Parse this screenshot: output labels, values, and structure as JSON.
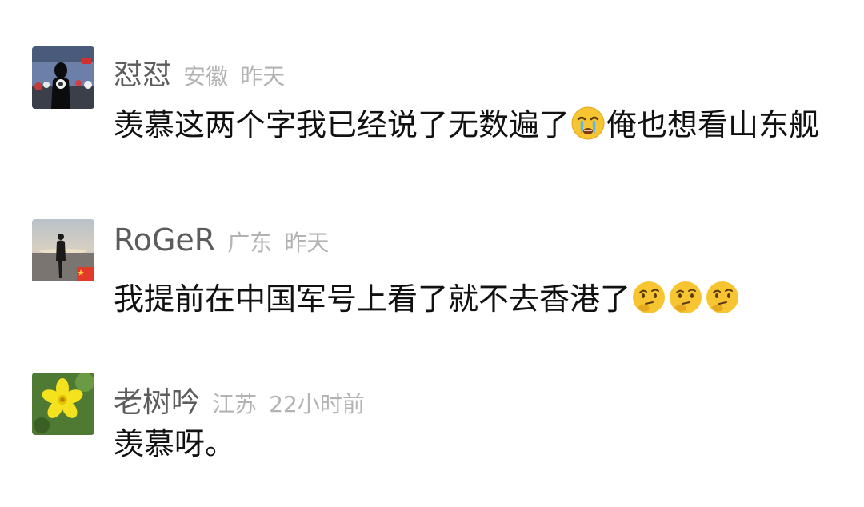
{
  "comments": [
    {
      "username": "怼怼",
      "location": "安徽",
      "time": "昨天",
      "text_before_emoji": "羡慕这两个字我已经说了无数遍了",
      "emoji": "crying-face-icon",
      "text_after_emoji": "俺也想看山东舰"
    },
    {
      "username": "RoGeR",
      "location": "广东",
      "time": "昨天",
      "text": "我提前在中国军号上看了就不去香港了",
      "emojis": [
        "thinking-face-icon",
        "thinking-face-icon",
        "thinking-face-icon"
      ],
      "badge": "china-flag-icon"
    },
    {
      "username": "老树吟",
      "location": "江苏",
      "time": "22小时前",
      "text": "羡慕呀。"
    }
  ],
  "colors": {
    "username": "#5c5c5c",
    "meta": "#b3b3b3",
    "body": "#111111",
    "emoji_yellow": "#f7c531"
  }
}
